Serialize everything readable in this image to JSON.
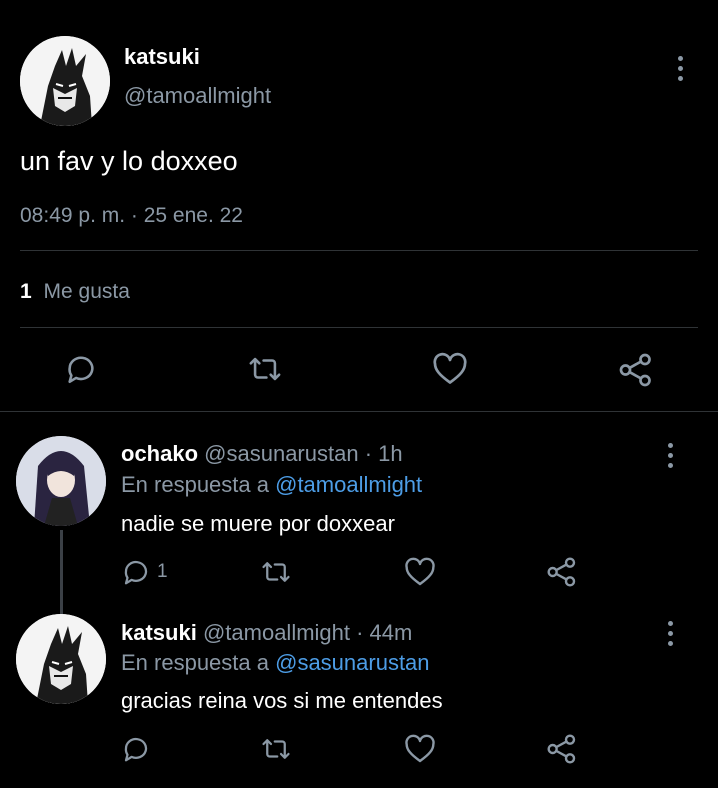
{
  "main_tweet": {
    "display_name": "katsuki",
    "handle": "@tamoallmight",
    "text": "un fav y lo doxxeo",
    "timestamp": "08:49 p. m. · 25 ene. 22",
    "likes_count": "1",
    "likes_label": "Me gusta"
  },
  "replies": [
    {
      "display_name": "ochako",
      "handle_time": "@sasunarustan · 1h",
      "reply_prefix": "En respuesta a",
      "reply_to": "@tamoallmight",
      "text": "nadie se muere por doxxear",
      "reply_count": "1"
    },
    {
      "display_name": "katsuki",
      "handle_time": "@tamoallmight · 44m",
      "reply_prefix": "En respuesta a",
      "reply_to": "@sasunarustan",
      "text": "gracias reina vos si me entendes",
      "reply_count": ""
    }
  ],
  "icons": [
    "reply-icon",
    "retweet-icon",
    "like-icon",
    "share-icon",
    "more-icon"
  ],
  "colors": {
    "background": "#000000",
    "muted": "#8b98a5",
    "link": "#4d9de6",
    "divider": "#2f3336"
  }
}
